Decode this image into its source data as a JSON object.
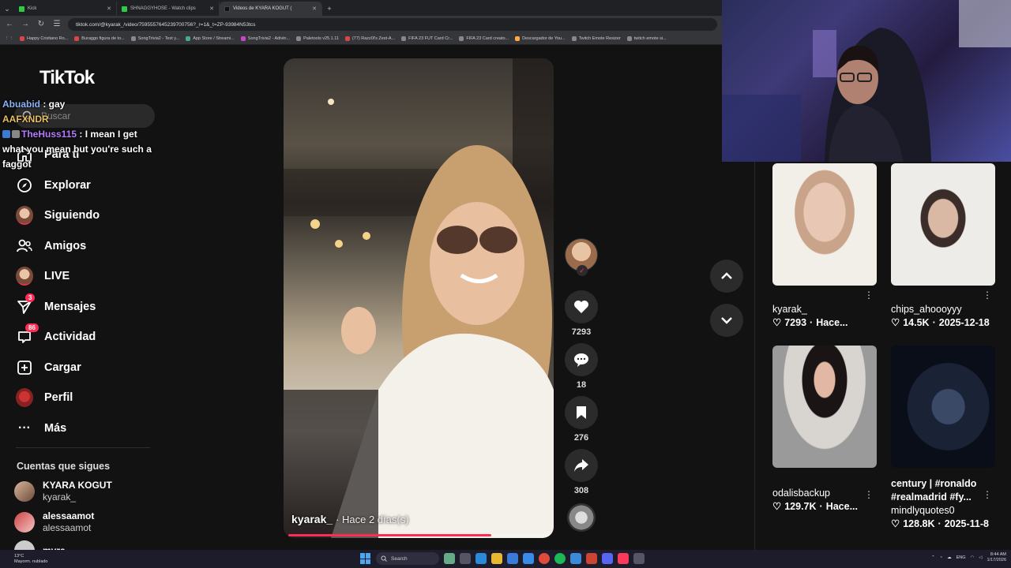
{
  "browser": {
    "tabs": [
      {
        "title": "Kick",
        "active": false
      },
      {
        "title": "SHNAGGYHOSE - Watch clips",
        "active": false
      },
      {
        "title": "Videos de KYARA KOGUT (",
        "active": true
      }
    ],
    "new_tab": "+",
    "url": "tiktok.com/@kyarak_/video/7595557645239700756?_r=1&_t=ZP-93984N53tcs",
    "bookmarks": [
      "Happy Cristiano Ro...",
      "Buraggo figura de to...",
      "SongTrivia2 - Test y...",
      "App Store / Streami...",
      "SongTrivia2 - Adivin...",
      "Paletools v25.1.11",
      "(77) Razz0l's Zest-A...",
      "FIFA 23 FUT Card Cr...",
      "FIFA 23 Card creato...",
      "Descargador de You...",
      "Twitch Emote Resizer",
      "twitch emote si..."
    ]
  },
  "tiktok": {
    "logo": "TikTok",
    "search_placeholder": "Buscar",
    "nav": [
      {
        "label": "Para ti",
        "icon": "home-icon"
      },
      {
        "label": "Explorar",
        "icon": "compass-icon"
      },
      {
        "label": "Siguiendo",
        "icon": "following-avatar-icon"
      },
      {
        "label": "Amigos",
        "icon": "friends-icon"
      },
      {
        "label": "LIVE",
        "icon": "live-avatar-icon"
      },
      {
        "label": "Mensajes",
        "icon": "send-icon",
        "badge": "3"
      },
      {
        "label": "Actividad",
        "icon": "inbox-icon",
        "badge": "86"
      },
      {
        "label": "Cargar",
        "icon": "upload-icon"
      },
      {
        "label": "Perfil",
        "icon": "profile-avatar-icon"
      },
      {
        "label": "Más",
        "icon": "more-icon"
      }
    ],
    "following_title": "Cuentas que sigues",
    "following": [
      {
        "name": "KYARA KOGUT",
        "handle": "kyarak_"
      },
      {
        "name": "alessaamot",
        "handle": "alessaamot"
      },
      {
        "name": "myra",
        "handle": ""
      }
    ],
    "video": {
      "author": "kyarak_",
      "time": "· Hace 2 días(s)",
      "progress": 0.78
    },
    "actions": {
      "likes": "7293",
      "comments": "18",
      "saves": "276",
      "shares": "308"
    },
    "related": [
      {
        "title": "kyarak_",
        "stat": "7293",
        "date": "Hace..."
      },
      {
        "title": "chips_ahoooyyy",
        "stat": "14.5K",
        "date": "2025-12-18"
      },
      {
        "title": "odalisbackup",
        "stat": "129.7K",
        "date": "Hace..."
      },
      {
        "title": "century | #ronaldo #realmadrid #fy...",
        "subtitle": "mindlyquotes0",
        "stat": "128.8K",
        "date": "2025-11-8"
      }
    ]
  },
  "chat": [
    {
      "user": "Abuabid",
      "message": " : gay"
    },
    {
      "user": "AAFXNDR",
      "message": ""
    },
    {
      "user": "TheHuss115",
      "message": " : I mean I get what you mean but you're such a faggot"
    }
  ],
  "taskbar": {
    "weather_temp": "13°C",
    "weather_desc": "Mayorm. nublado",
    "search": "Search",
    "lang": "ENG",
    "time": "8:44 AM",
    "date": "1/17/2026"
  }
}
